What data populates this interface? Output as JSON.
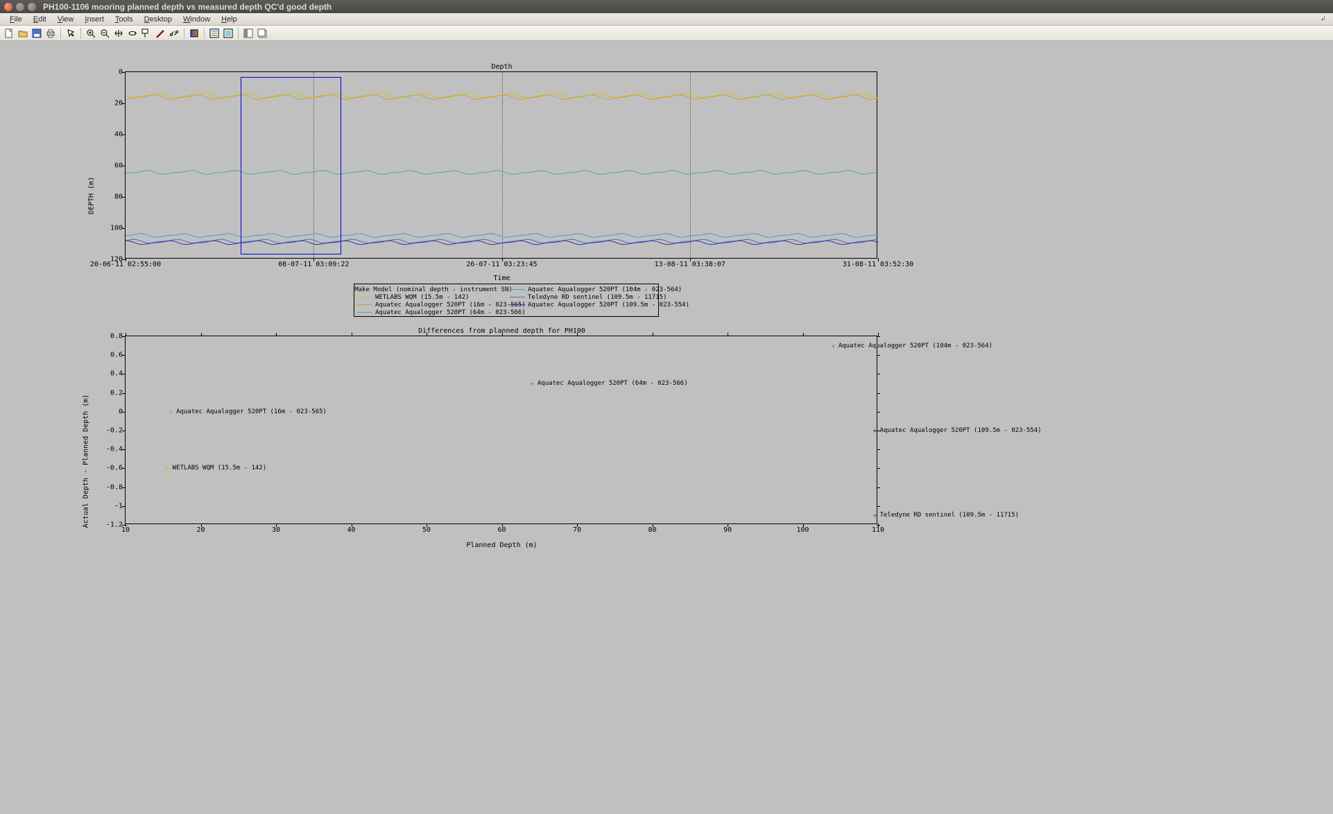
{
  "window": {
    "title": "PH100-1106 mooring planned depth vs measured depth QC'd good depth"
  },
  "menu": [
    "File",
    "Edit",
    "View",
    "Insert",
    "Tools",
    "Desktop",
    "Window",
    "Help"
  ],
  "toolbar_icons": [
    "new-file",
    "open-file",
    "save",
    "print",
    "sep",
    "pointer",
    "sep",
    "zoom-in",
    "zoom-out",
    "pan",
    "rotate-3d",
    "data-cursor",
    "brush",
    "link",
    "sep",
    "colorbar",
    "sep",
    "insert-legend",
    "hide-plot-tools",
    "sep",
    "dock",
    "undock"
  ],
  "chart_data": [
    {
      "type": "line",
      "title": "Depth",
      "xlabel": "Time",
      "ylabel": "DEPTH (m)",
      "y_reversed": true,
      "ylim": [
        0,
        120
      ],
      "x_ticks": [
        "20-06-11 02:55:00",
        "08-07-11 03:09:22",
        "26-07-11 03:23:45",
        "13-08-11 03:38:07",
        "31-08-11 03:52:30"
      ],
      "y_ticks": [
        0,
        20,
        40,
        60,
        80,
        100,
        120
      ],
      "selection_box": {
        "x_range_frac": [
          0.153,
          0.287
        ],
        "y_range": [
          3,
          117
        ]
      },
      "legend_header": "Make Model (nominal depth - instrument SN)",
      "series": [
        {
          "name": "WETLABS WQM (15.5m - 142)",
          "color": "#cfc21a",
          "mean_depth": 15,
          "amp": 1.2
        },
        {
          "name": "Aquatec Aqualogger 520PT (16m - 023-565)",
          "color": "#c7a33a",
          "mean_depth": 16,
          "amp": 1.2
        },
        {
          "name": "Aquatec Aqualogger 520PT (64m - 023-566)",
          "color": "#5fa776",
          "mean_depth": 64.3,
          "amp": 1.0
        },
        {
          "name": "Aquatec Aqualogger 520PT (104m - 023-564)",
          "color": "#3aa4c5",
          "mean_depth": 104.7,
          "amp": 1.0
        },
        {
          "name": "Teledyne RD sentinel (109.5m - 11715)",
          "color": "#4a6ecf",
          "mean_depth": 108.4,
          "amp": 1.0
        },
        {
          "name": "Aquatec Aqualogger 520PT (109.5m - 023-554)",
          "color": "#33359c",
          "mean_depth": 109.3,
          "amp": 1.0
        }
      ]
    },
    {
      "type": "scatter",
      "title": "Differences from planned depth for PH100",
      "xlabel": "Planned Depth (m)",
      "ylabel": "Actual Depth - Planned Depth (m)",
      "xlim": [
        10,
        110
      ],
      "ylim": [
        -1.2,
        0.8
      ],
      "x_ticks": [
        10,
        20,
        30,
        40,
        50,
        60,
        70,
        80,
        90,
        100,
        110
      ],
      "y_ticks": [
        -1.2,
        -1,
        -0.8,
        -0.6,
        -0.4,
        -0.2,
        0,
        0.2,
        0.4,
        0.6,
        0.8
      ],
      "points": [
        {
          "x": 15.5,
          "y": -0.6,
          "label": "WETLABS WQM (15.5m - 142)",
          "color": "#cfc21a"
        },
        {
          "x": 16,
          "y": 0.0,
          "label": "Aquatec Aqualogger 520PT (16m - 023-565)",
          "color": "#c7a33a"
        },
        {
          "x": 64,
          "y": 0.3,
          "label": "Aquatec Aqualogger 520PT (64m - 023-566)",
          "color": "#5fa776"
        },
        {
          "x": 104,
          "y": 0.7,
          "label": "Aquatec Aqualogger 520PT (104m - 023-564)",
          "color": "#3aa4c5"
        },
        {
          "x": 109.5,
          "y": -0.2,
          "label": "Aquatec Aqualogger 520PT (109.5m - 023-554)",
          "color": "#33359c"
        },
        {
          "x": 109.5,
          "y": -1.1,
          "label": "Teledyne RD sentinel (109.5m - 11715)",
          "color": "#4a6ecf"
        }
      ]
    }
  ]
}
